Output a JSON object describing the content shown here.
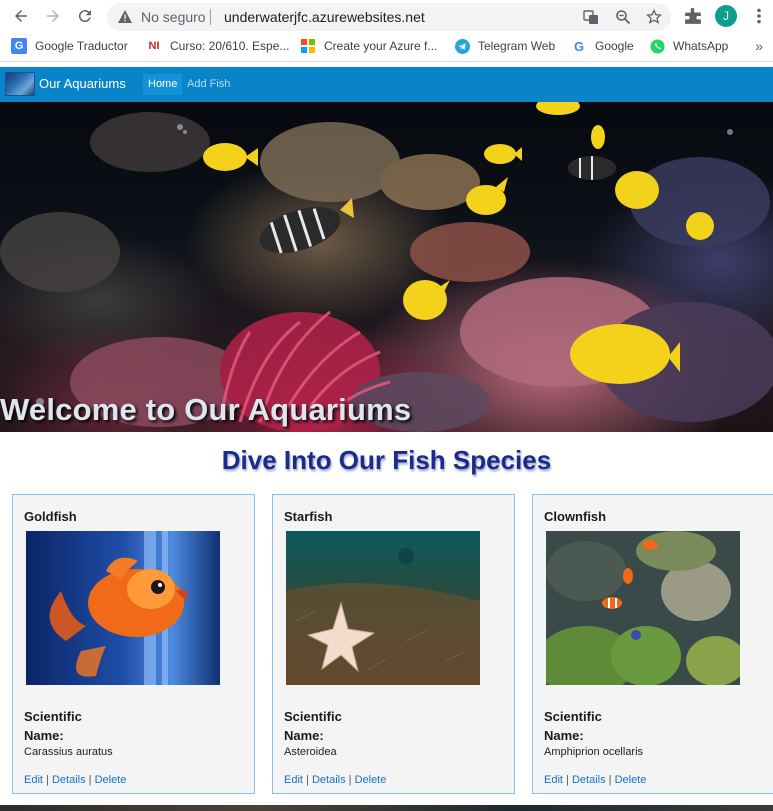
{
  "browser": {
    "not_secure": "No seguro",
    "url": "underwaterjfc.azurewebsites.net",
    "avatar_letter": "J",
    "bookmarks": [
      {
        "label": "Google Traductor",
        "icon": "google-translate-icon",
        "color": "#4285f4"
      },
      {
        "label": "Curso: 20/610. Espe...",
        "icon": "ni-icon",
        "color": "#c62828"
      },
      {
        "label": "Create your Azure f...",
        "icon": "microsoft-icon",
        "color": "#f25022"
      },
      {
        "label": "Telegram Web",
        "icon": "telegram-icon",
        "color": "#2aa3dd"
      },
      {
        "label": "Google",
        "icon": "google-icon",
        "color": "#4285f4"
      },
      {
        "label": "WhatsApp",
        "icon": "whatsapp-icon",
        "color": "#25d366"
      }
    ]
  },
  "site": {
    "brand": "Our Aquariums",
    "nav": [
      {
        "label": "Home",
        "active": true
      },
      {
        "label": "Add Fish",
        "active": false
      }
    ],
    "hero_title": "Welcome to Our Aquariums",
    "section_title": "Dive Into Our Fish Species",
    "scientific_label": "Scientific Name:",
    "actions": {
      "edit": "Edit",
      "details": "Details",
      "delete": "Delete",
      "separator": "|"
    },
    "fish": [
      {
        "name": "Goldfish",
        "scientific": "Carassius auratus"
      },
      {
        "name": "Starfish",
        "scientific": "Asteroidea"
      },
      {
        "name": "Clownfish",
        "scientific": "Amphiprion ocellaris"
      }
    ]
  },
  "colors": {
    "nav_bar": "#0a84c9",
    "title_blue": "#1a2b8c",
    "card_border": "#8cc0e4",
    "link": "#1673c2"
  }
}
